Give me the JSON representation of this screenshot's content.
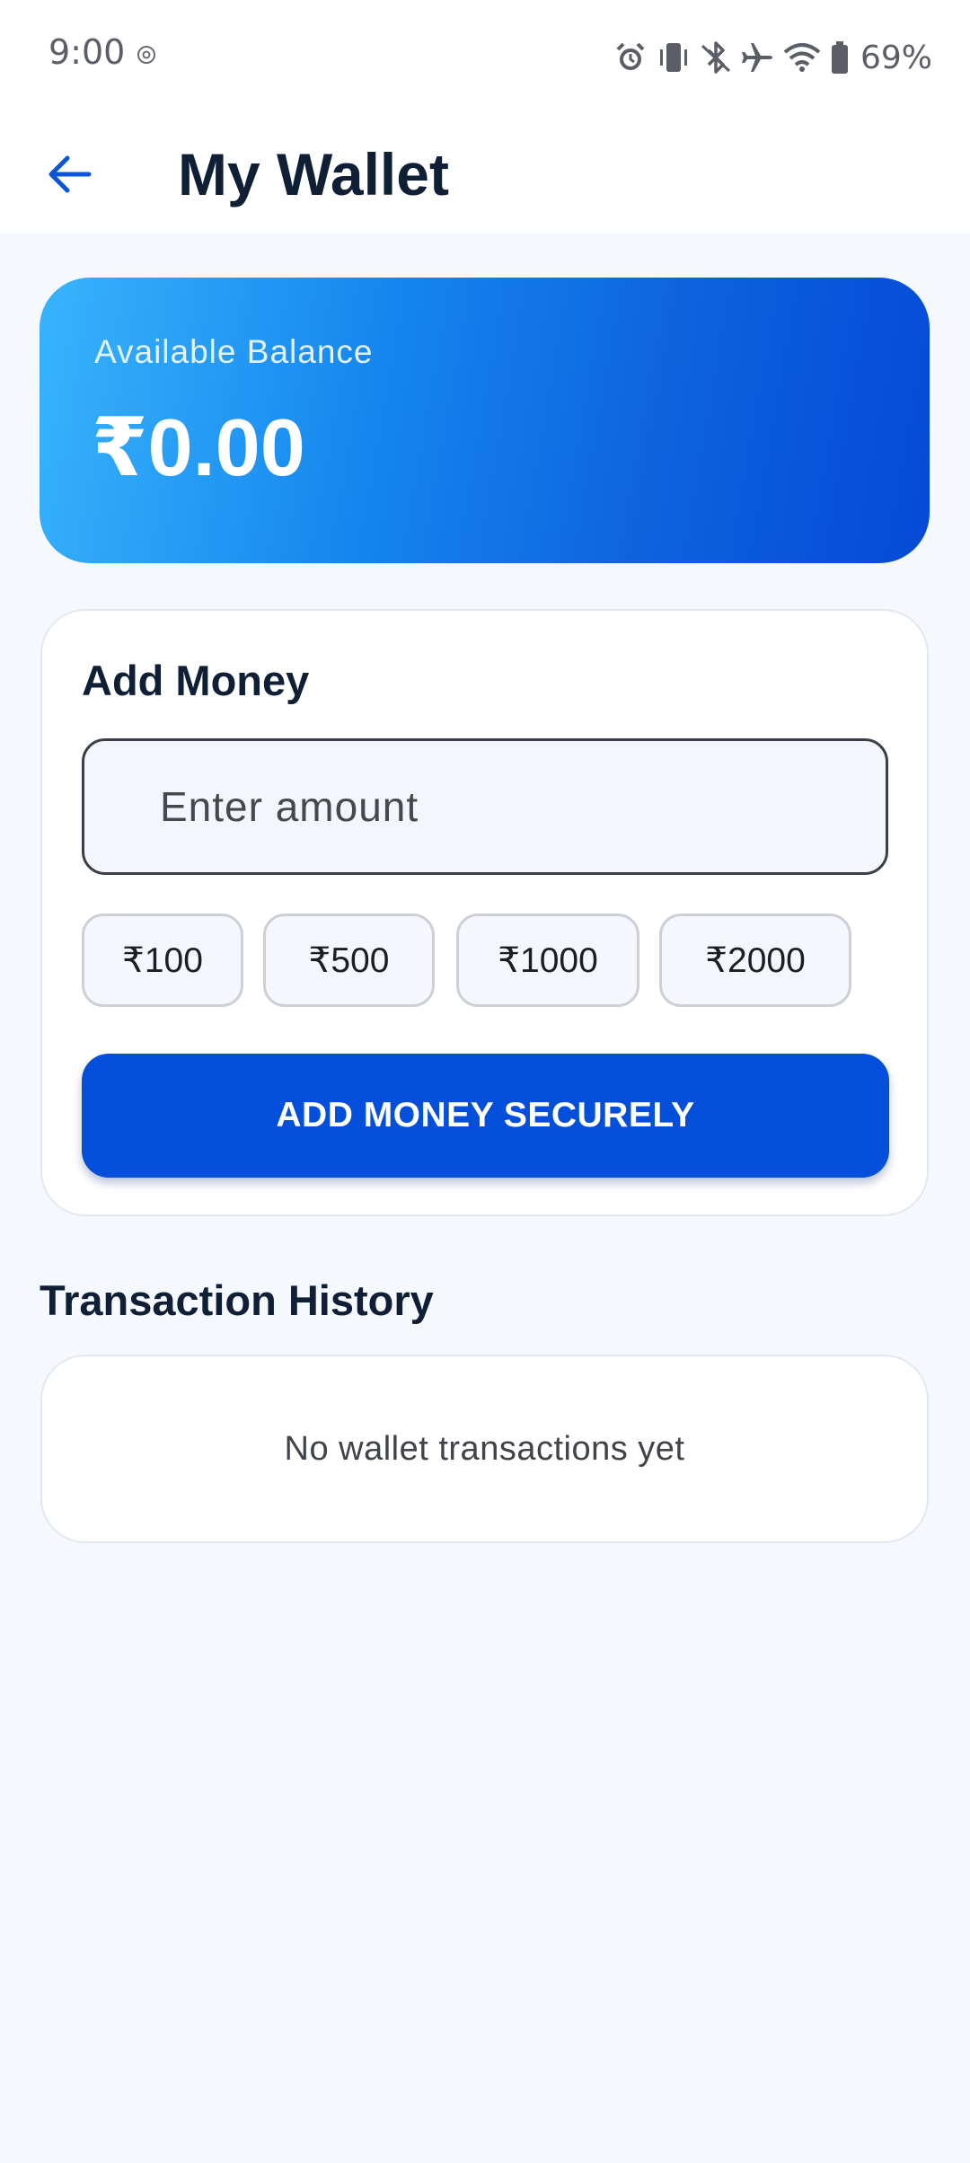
{
  "status_bar": {
    "time": "9:00",
    "battery_percent": "69%",
    "icons": [
      "at-icon",
      "alarm-icon",
      "vibrate-icon",
      "bluetooth-icon",
      "airplane-mode-icon",
      "wifi-icon",
      "battery-icon"
    ]
  },
  "app_bar": {
    "back_icon": "arrow-left-icon",
    "title": "My Wallet"
  },
  "balance_card": {
    "label": "Available Balance",
    "value": "₹0.00"
  },
  "add_money": {
    "title": "Add Money",
    "input_placeholder": "Enter amount",
    "input_value": "",
    "quick_amounts": [
      "₹100",
      "₹500",
      "₹1000",
      "₹2000"
    ],
    "button_label": "ADD MONEY SECURELY"
  },
  "transaction_history": {
    "title": "Transaction History",
    "empty_message": "No wallet transactions yet"
  },
  "colors": {
    "accent": "#034fdc",
    "gradient_start": "#38b4fb",
    "gradient_end": "#0449d6",
    "background": "#f5f8fd",
    "text_primary": "#0f1f36"
  }
}
